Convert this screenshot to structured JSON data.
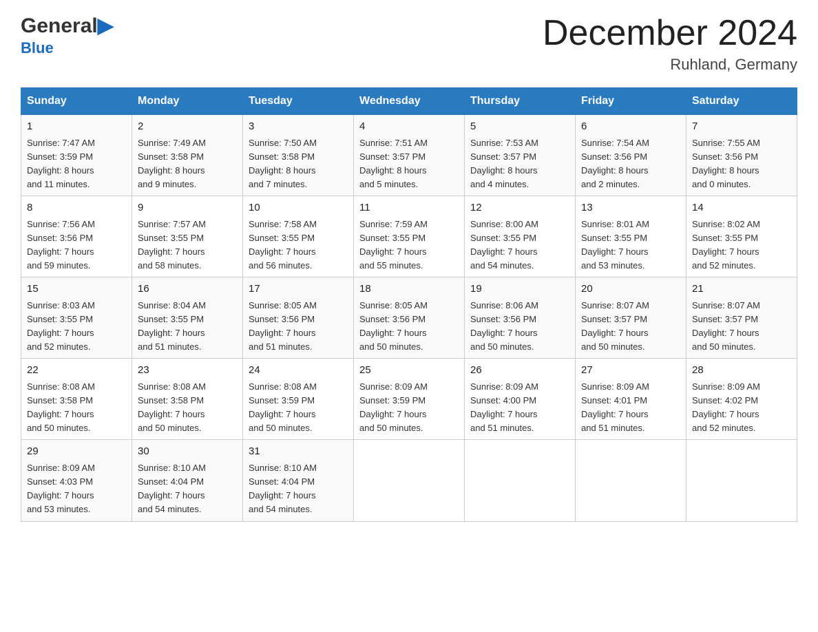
{
  "header": {
    "logo": {
      "general": "General",
      "blue": "Blue"
    },
    "title": "December 2024",
    "location": "Ruhland, Germany"
  },
  "calendar": {
    "days_of_week": [
      "Sunday",
      "Monday",
      "Tuesday",
      "Wednesday",
      "Thursday",
      "Friday",
      "Saturday"
    ],
    "weeks": [
      [
        {
          "day": "1",
          "sunrise": "7:47 AM",
          "sunset": "3:59 PM",
          "daylight": "8 hours and 11 minutes."
        },
        {
          "day": "2",
          "sunrise": "7:49 AM",
          "sunset": "3:58 PM",
          "daylight": "8 hours and 9 minutes."
        },
        {
          "day": "3",
          "sunrise": "7:50 AM",
          "sunset": "3:58 PM",
          "daylight": "8 hours and 7 minutes."
        },
        {
          "day": "4",
          "sunrise": "7:51 AM",
          "sunset": "3:57 PM",
          "daylight": "8 hours and 5 minutes."
        },
        {
          "day": "5",
          "sunrise": "7:53 AM",
          "sunset": "3:57 PM",
          "daylight": "8 hours and 4 minutes."
        },
        {
          "day": "6",
          "sunrise": "7:54 AM",
          "sunset": "3:56 PM",
          "daylight": "8 hours and 2 minutes."
        },
        {
          "day": "7",
          "sunrise": "7:55 AM",
          "sunset": "3:56 PM",
          "daylight": "8 hours and 0 minutes."
        }
      ],
      [
        {
          "day": "8",
          "sunrise": "7:56 AM",
          "sunset": "3:56 PM",
          "daylight": "7 hours and 59 minutes."
        },
        {
          "day": "9",
          "sunrise": "7:57 AM",
          "sunset": "3:55 PM",
          "daylight": "7 hours and 58 minutes."
        },
        {
          "day": "10",
          "sunrise": "7:58 AM",
          "sunset": "3:55 PM",
          "daylight": "7 hours and 56 minutes."
        },
        {
          "day": "11",
          "sunrise": "7:59 AM",
          "sunset": "3:55 PM",
          "daylight": "7 hours and 55 minutes."
        },
        {
          "day": "12",
          "sunrise": "8:00 AM",
          "sunset": "3:55 PM",
          "daylight": "7 hours and 54 minutes."
        },
        {
          "day": "13",
          "sunrise": "8:01 AM",
          "sunset": "3:55 PM",
          "daylight": "7 hours and 53 minutes."
        },
        {
          "day": "14",
          "sunrise": "8:02 AM",
          "sunset": "3:55 PM",
          "daylight": "7 hours and 52 minutes."
        }
      ],
      [
        {
          "day": "15",
          "sunrise": "8:03 AM",
          "sunset": "3:55 PM",
          "daylight": "7 hours and 52 minutes."
        },
        {
          "day": "16",
          "sunrise": "8:04 AM",
          "sunset": "3:55 PM",
          "daylight": "7 hours and 51 minutes."
        },
        {
          "day": "17",
          "sunrise": "8:05 AM",
          "sunset": "3:56 PM",
          "daylight": "7 hours and 51 minutes."
        },
        {
          "day": "18",
          "sunrise": "8:05 AM",
          "sunset": "3:56 PM",
          "daylight": "7 hours and 50 minutes."
        },
        {
          "day": "19",
          "sunrise": "8:06 AM",
          "sunset": "3:56 PM",
          "daylight": "7 hours and 50 minutes."
        },
        {
          "day": "20",
          "sunrise": "8:07 AM",
          "sunset": "3:57 PM",
          "daylight": "7 hours and 50 minutes."
        },
        {
          "day": "21",
          "sunrise": "8:07 AM",
          "sunset": "3:57 PM",
          "daylight": "7 hours and 50 minutes."
        }
      ],
      [
        {
          "day": "22",
          "sunrise": "8:08 AM",
          "sunset": "3:58 PM",
          "daylight": "7 hours and 50 minutes."
        },
        {
          "day": "23",
          "sunrise": "8:08 AM",
          "sunset": "3:58 PM",
          "daylight": "7 hours and 50 minutes."
        },
        {
          "day": "24",
          "sunrise": "8:08 AM",
          "sunset": "3:59 PM",
          "daylight": "7 hours and 50 minutes."
        },
        {
          "day": "25",
          "sunrise": "8:09 AM",
          "sunset": "3:59 PM",
          "daylight": "7 hours and 50 minutes."
        },
        {
          "day": "26",
          "sunrise": "8:09 AM",
          "sunset": "4:00 PM",
          "daylight": "7 hours and 51 minutes."
        },
        {
          "day": "27",
          "sunrise": "8:09 AM",
          "sunset": "4:01 PM",
          "daylight": "7 hours and 51 minutes."
        },
        {
          "day": "28",
          "sunrise": "8:09 AM",
          "sunset": "4:02 PM",
          "daylight": "7 hours and 52 minutes."
        }
      ],
      [
        {
          "day": "29",
          "sunrise": "8:09 AM",
          "sunset": "4:03 PM",
          "daylight": "7 hours and 53 minutes."
        },
        {
          "day": "30",
          "sunrise": "8:10 AM",
          "sunset": "4:04 PM",
          "daylight": "7 hours and 54 minutes."
        },
        {
          "day": "31",
          "sunrise": "8:10 AM",
          "sunset": "4:04 PM",
          "daylight": "7 hours and 54 minutes."
        },
        null,
        null,
        null,
        null
      ]
    ],
    "labels": {
      "sunrise": "Sunrise: ",
      "sunset": "Sunset: ",
      "daylight": "Daylight: "
    }
  }
}
